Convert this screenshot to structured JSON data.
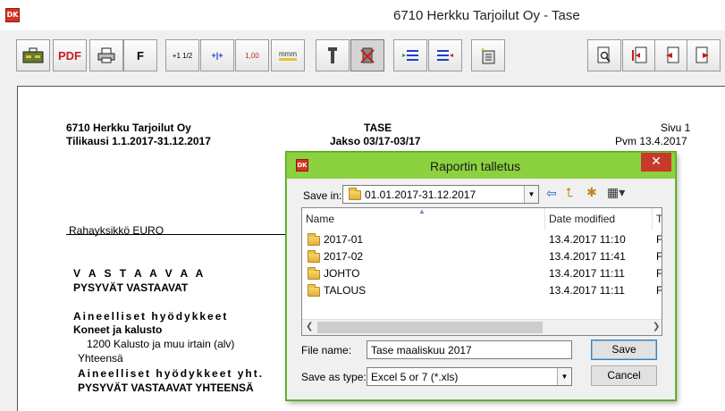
{
  "window": {
    "icon_text": "DK",
    "title": "6710 Herkku Tarjoilut Oy - Tase"
  },
  "toolbar": {
    "pdf_label": "PDF",
    "font_label": "F",
    "fraction_label": "+1 1/2",
    "columns_label": "+|+",
    "decimal_label": "1,00",
    "ruler_label": "mmm"
  },
  "report": {
    "company": "6710 Herkku Tarjoilut Oy",
    "period": "Tilikausi 1.1.2017-31.12.2017",
    "title": "TASE",
    "jakso": "Jakso 03/17-03/17",
    "page": "Sivu 1",
    "date": "Pvm 13.4.2017",
    "currency": "Rahayksikkö EURO",
    "lines": [
      "V A S T A A V A A",
      "PYSYVÄT VASTAAVAT",
      "Aineelliset hyödykkeet",
      "Koneet ja kalusto",
      "1200 Kalusto ja muu irtain (alv)",
      "Yhteensä",
      "Aineelliset hyödykkeet yht.",
      "PYSYVÄT VASTAAVAT YHTEENSÄ"
    ]
  },
  "dialog": {
    "icon_text": "DK",
    "title": "Raportin talletus",
    "close_label": "✕",
    "save_in_label": "Save in:",
    "save_in_value": "01.01.2017-31.12.2017",
    "columns": {
      "name": "Name",
      "date_modified": "Date modified",
      "type": "Ty"
    },
    "files": [
      {
        "name": "2017-01",
        "date": "13.4.2017 11:10",
        "type": "Fi"
      },
      {
        "name": "2017-02",
        "date": "13.4.2017 11:41",
        "type": "Fi"
      },
      {
        "name": "JOHTO",
        "date": "13.4.2017 11:11",
        "type": "Fi"
      },
      {
        "name": "TALOUS",
        "date": "13.4.2017 11:11",
        "type": "Fi"
      }
    ],
    "file_name_label": "File name:",
    "file_name_value": "Tase maaliskuu 2017",
    "save_as_type_label": "Save as type:",
    "save_as_type_value": "Excel 5 or 7 (*.xls)",
    "save_button": "Save",
    "cancel_button": "Cancel"
  }
}
